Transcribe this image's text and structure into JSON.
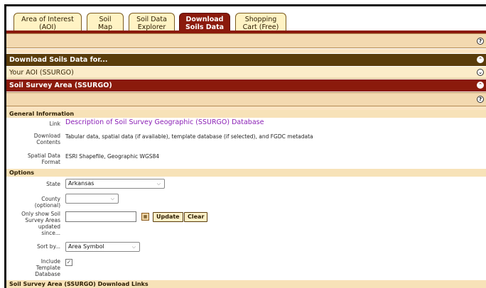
{
  "tabs": [
    {
      "label_line1": "Area of Interest",
      "label_line2": "(AOI)"
    },
    {
      "label_line1": "Soil",
      "label_line2": "Map"
    },
    {
      "label_line1": "Soil Data",
      "label_line2": "Explorer"
    },
    {
      "label_line1": "Download",
      "label_line2": "Soils Data"
    },
    {
      "label_line1": "Shopping",
      "label_line2": "Cart (Free)"
    }
  ],
  "active_tab": "Download Soils Data",
  "bars": {
    "download_for": "Download Soils Data for...",
    "your_aoi": "Your AOI (SSURGO)",
    "ssa": "Soil Survey Area (SSURGO)"
  },
  "help_icon": "?",
  "general": {
    "heading": "General Information",
    "link_label": "Link",
    "link_text": "Description of Soil Survey Geographic (SSURGO) Database",
    "contents_label_1": "Download",
    "contents_label_2": "Contents",
    "contents_value": "Tabular data, spatial data (if available), template database (if selected), and FGDC metadata",
    "format_label_1": "Spatial Data",
    "format_label_2": "Format",
    "format_value": "ESRI Shapefile, Geographic WGS84"
  },
  "options": {
    "heading": "Options",
    "state_label": "State",
    "state_value": "Arkansas",
    "county_label_1": "County",
    "county_label_2": "(optional)",
    "county_value": "",
    "updated_label_1": "Only show Soil",
    "updated_label_2": "Survey Areas",
    "updated_label_3": "updated",
    "updated_label_4": "since...",
    "update_button": "Update",
    "clear_button": "Clear",
    "sort_label": "Sort by...",
    "sort_value": "Area Symbol",
    "include_label_1": "Include",
    "include_label_2": "Template",
    "include_label_3": "Database"
  },
  "links_heading": "Soil Survey Area (SSURGO) Download Links",
  "colors": {
    "accent_red": "#8b1a0c",
    "dark_brown": "#5a3c0a",
    "tan": "#f3d9b0",
    "link": "#8a1fb5"
  }
}
